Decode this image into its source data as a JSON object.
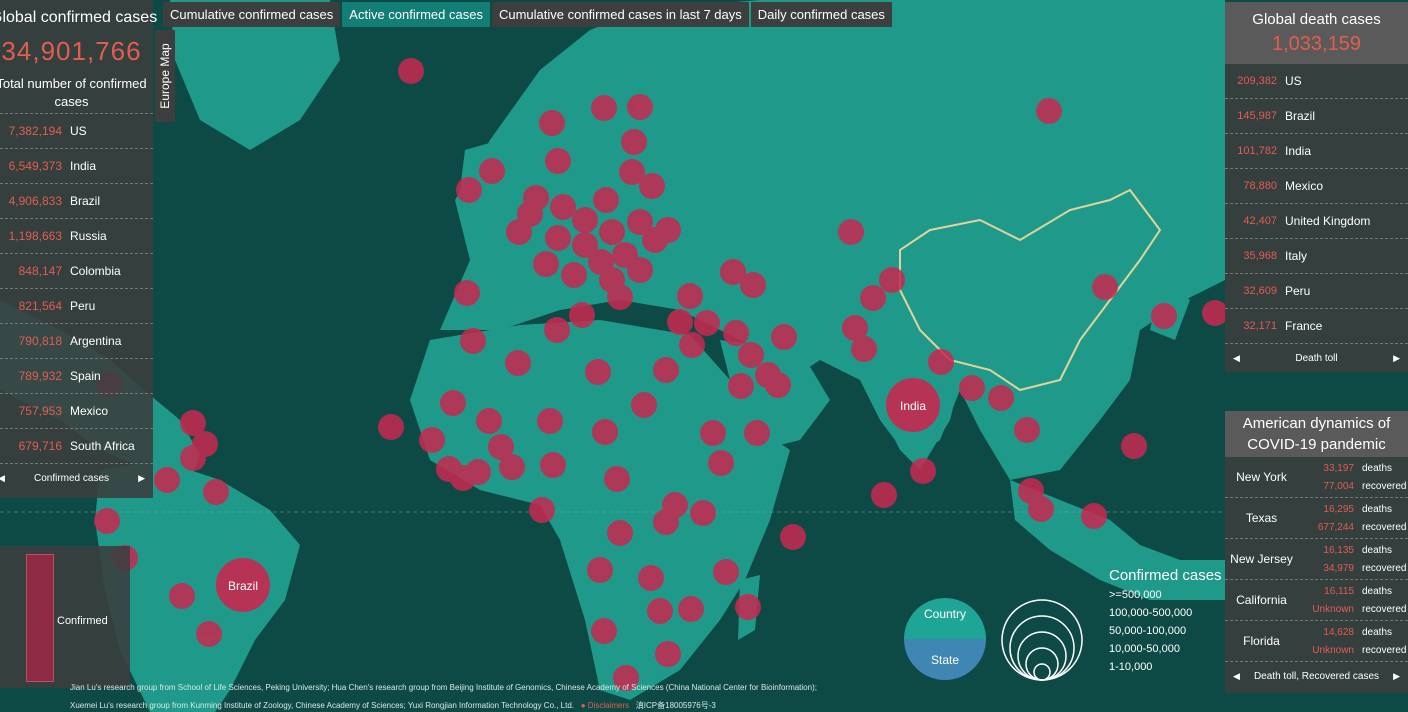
{
  "tabs": [
    "Cumulative confirmed cases",
    "Active confirmed cases",
    "Cumulative confirmed cases in last 7 days",
    "Daily confirmed cases"
  ],
  "europe_map_label": "Europe Map",
  "left_panel": {
    "title": "Global confirmed cases",
    "total": "34,901,766",
    "subtitle": "Total number of confirmed cases",
    "rows": [
      {
        "num": "7,382,194",
        "name": "US"
      },
      {
        "num": "6,549,373",
        "name": "India"
      },
      {
        "num": "4,906,833",
        "name": "Brazil"
      },
      {
        "num": "1,198,663",
        "name": "Russia"
      },
      {
        "num": "848,147",
        "name": "Colombia"
      },
      {
        "num": "821,564",
        "name": "Peru"
      },
      {
        "num": "790,818",
        "name": "Argentina"
      },
      {
        "num": "789,932",
        "name": "Spain"
      },
      {
        "num": "757,953",
        "name": "Mexico"
      },
      {
        "num": "679,716",
        "name": "South Africa"
      }
    ],
    "pager_label": "Confirmed cases"
  },
  "right_panel": {
    "title": "Global death cases",
    "total": "1,033,159",
    "rows": [
      {
        "num": "209,382",
        "name": "US"
      },
      {
        "num": "145,987",
        "name": "Brazil"
      },
      {
        "num": "101,782",
        "name": "India"
      },
      {
        "num": "78,880",
        "name": "Mexico"
      },
      {
        "num": "42,407",
        "name": "United Kingdom"
      },
      {
        "num": "35,968",
        "name": "Italy"
      },
      {
        "num": "32,609",
        "name": "Peru"
      },
      {
        "num": "32,171",
        "name": "France"
      }
    ],
    "pager_label": "Death toll"
  },
  "american_panel": {
    "title": "American dynamics of COVID-19 pandemic",
    "deaths_label": "deaths",
    "recovered_label": "recovered",
    "states": [
      {
        "name": "New York",
        "deaths": "33,197",
        "recovered": "77,004"
      },
      {
        "name": "Texas",
        "deaths": "16,295",
        "recovered": "677,244"
      },
      {
        "name": "New Jersey",
        "deaths": "16,135",
        "recovered": "34,979"
      },
      {
        "name": "California",
        "deaths": "16,115",
        "recovered": "Unknown"
      },
      {
        "name": "Florida",
        "deaths": "14,628",
        "recovered": "Unknown"
      }
    ],
    "pager_label": "Death toll, Recovered cases"
  },
  "mini_chart_label": "Confirmed",
  "map_labels": {
    "india": "India",
    "brazil": "Brazil"
  },
  "toggle": {
    "country": "Country",
    "state": "State"
  },
  "legend": {
    "title": "Confirmed cases",
    "items": [
      ">=500,000",
      "100,000-500,000",
      "50,000-100,000",
      "10,000-50,000",
      "1-10,000"
    ]
  },
  "footer": {
    "line1": "Jian Lu's research group from School of Life Sciences, Peking University;    Hua Chen's research group from Beijing Institute of Genomics, Chinese Academy of Sciences (China National Center for Bioinformation);",
    "line2_a": "Xuemei Lu's research group from Kunming Institute of Zoology, Chinese Academy of Sciences;    Yuxi Rongjian Information Technology Co., Ltd.",
    "disclaimer": "Disclaimers",
    "icp": "滇ICP备18005976号-3"
  },
  "colors": {
    "ocean": "#0e4a45",
    "land": "#1f9a8a",
    "bubble": "#c8284f",
    "accent": "#e35d4f",
    "panel": "#3d3f3f"
  }
}
